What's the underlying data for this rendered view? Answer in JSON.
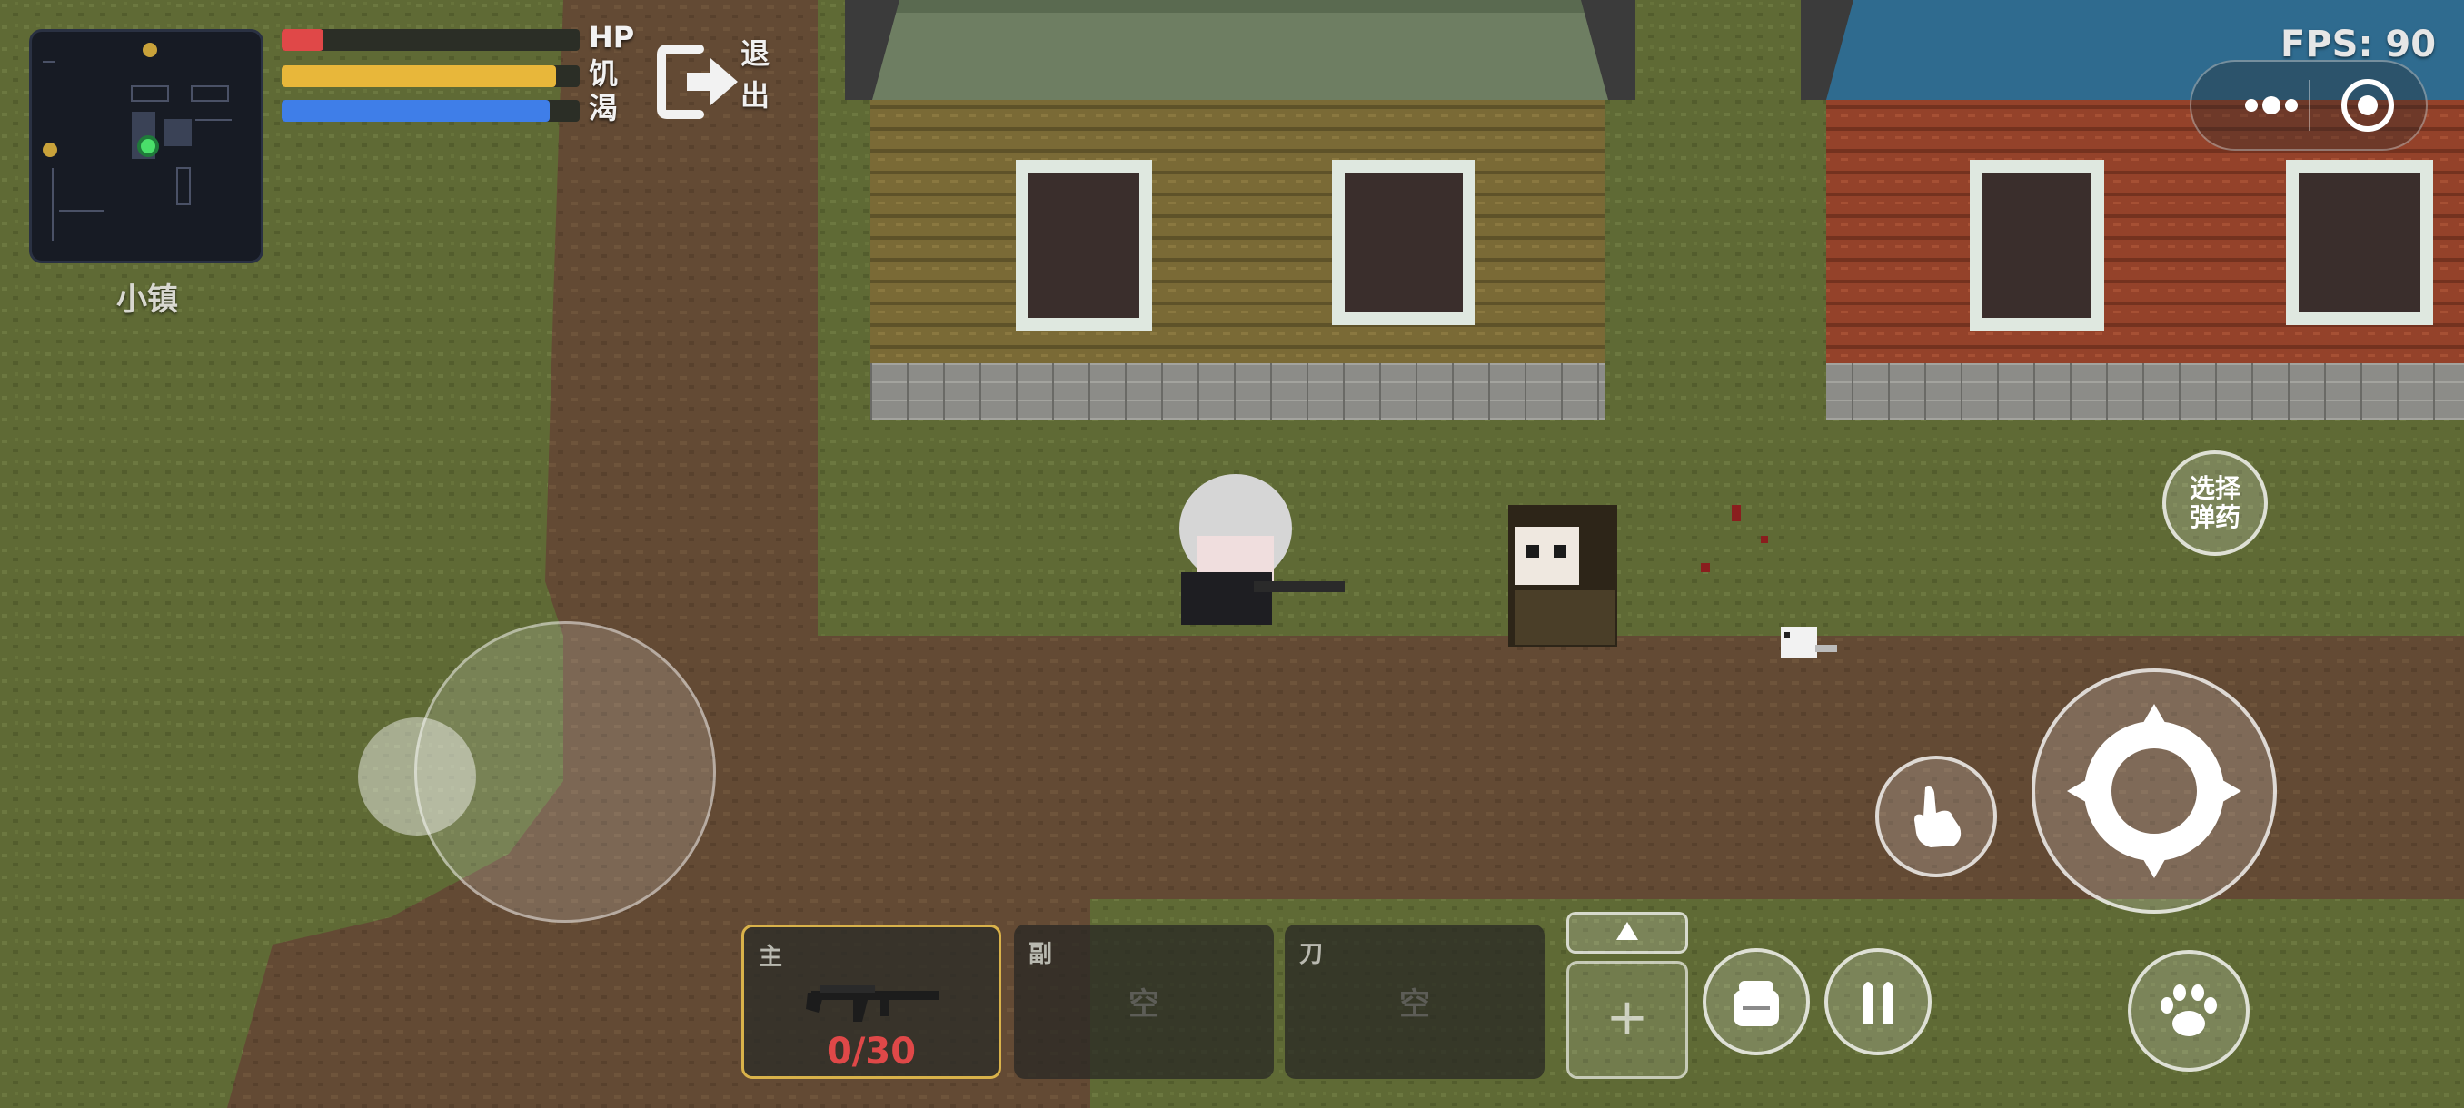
{
  "location": "小镇",
  "stats": {
    "hp_label": "HP",
    "hunger_label": "饥",
    "thirst_label": "渴",
    "hp": 0.14,
    "hunger": 0.92,
    "thirst": 0.9
  },
  "exit": {
    "label_1": "退",
    "label_2": "出"
  },
  "fps": "FPS: 90",
  "ammo_select": {
    "line_1": "选择",
    "line_2": "弹药"
  },
  "slots": {
    "main": {
      "tag": "主",
      "ammo": "0/30"
    },
    "sub": {
      "tag": "副",
      "empty": "空"
    },
    "knife": {
      "tag": "刀",
      "empty": "空"
    }
  },
  "quick_slot": {
    "up": "▲",
    "plus": "+"
  },
  "icons": [
    "exit-icon",
    "more-icon",
    "target-icon",
    "crosshair-icon",
    "hand-icon",
    "paw-icon",
    "backpack-icon",
    "bullets-icon",
    "rifle-icon"
  ],
  "colors": {
    "hp": "#e04848",
    "hunger": "#e8b73a",
    "thirst": "#3f7ee8",
    "selected_slot": "#d9b24a"
  }
}
